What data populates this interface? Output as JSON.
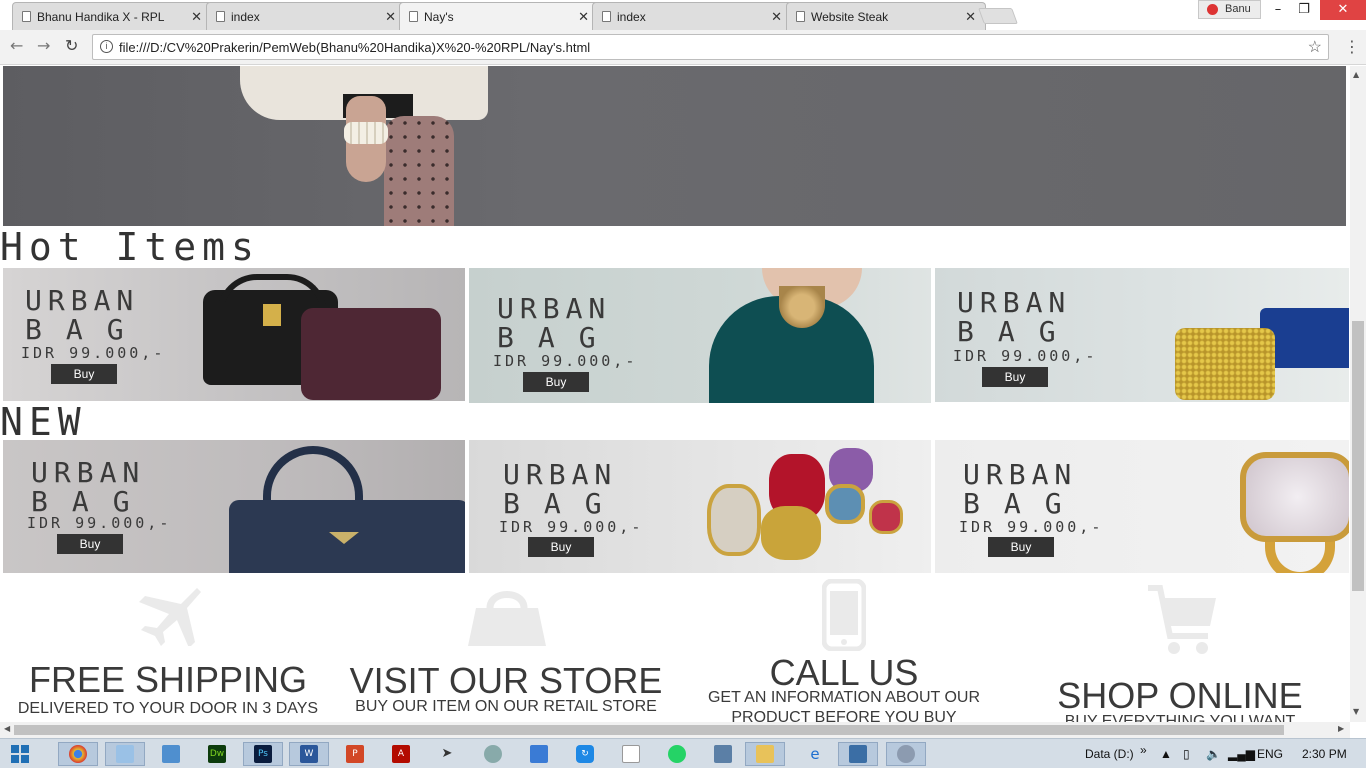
{
  "browser": {
    "tabs": [
      {
        "title": "Bhanu Handika X - RPL",
        "active": false
      },
      {
        "title": "index",
        "active": false
      },
      {
        "title": "Nay's",
        "active": true
      },
      {
        "title": "index",
        "active": false
      },
      {
        "title": "Website Steak",
        "active": false
      }
    ],
    "profile_name": "Banu",
    "url": "file:///D:/CV%20Prakerin/PemWeb(Bhanu%20Handika)X%20-%20RPL/Nay's.html"
  },
  "page": {
    "hot_items_title": "Hot Items",
    "new_title": "NEW",
    "product_line1": "URBAN",
    "product_line2": "BAG",
    "product_price": "IDR 99.000,-",
    "buy_label": "Buy",
    "hot_items": [
      {
        "image": "black-and-plum-handbags"
      },
      {
        "image": "model-teal-dress-gold-necklace"
      },
      {
        "image": "gold-and-blue-clutches"
      }
    ],
    "new_items": [
      {
        "image": "navy-prada-handbag"
      },
      {
        "image": "gemstone-rings"
      },
      {
        "image": "quartz-gold-ring"
      }
    ],
    "features": [
      {
        "icon": "airplane-icon",
        "title": "FREE SHIPPING",
        "subtitle": "DELIVERED TO YOUR DOOR IN 3 DAYS"
      },
      {
        "icon": "shopping-bag-icon",
        "title": "VISIT OUR STORE",
        "subtitle": "BUY OUR ITEM ON OUR RETAIL STORE"
      },
      {
        "icon": "mobile-phone-icon",
        "title": "CALL US",
        "subtitle": "GET AN INFORMATION ABOUT OUR PRODUCT BEFORE YOU BUY"
      },
      {
        "icon": "shopping-cart-icon",
        "title": "SHOP ONLINE",
        "subtitle": "BUY EVERYTHING YOU WANT"
      }
    ]
  },
  "taskbar": {
    "apps": [
      "start-icon",
      "chrome-icon",
      "notepad-icon",
      "box-icon",
      "dreamweaver-icon",
      "photoshop-icon",
      "word-icon",
      "powerpoint-icon",
      "acrobat-icon",
      "media-icon",
      "browser-icon",
      "network-icon",
      "sync-icon",
      "file-icon",
      "whatsapp-icon",
      "remote-icon",
      "explorer-icon",
      "ie-icon",
      "window-icon",
      "settings-icon"
    ],
    "drive_label": "Data (D:)",
    "language": "ENG",
    "time": "2:30 PM"
  }
}
